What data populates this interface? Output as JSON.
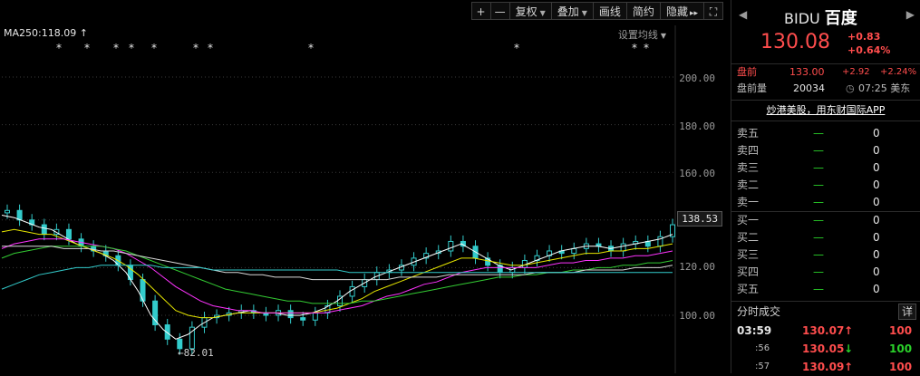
{
  "toolbar": {
    "zoom_in": "+",
    "zoom_out": "—",
    "adjust": "复权",
    "overlay": "叠加",
    "draw": "画线",
    "simple": "简约",
    "hide": "隐藏",
    "more": "▸▸",
    "expand": "⛶"
  },
  "chart": {
    "ma_label": "MA250:118.09",
    "ma_settings": "设置均线",
    "y_ticks": [
      "200.00",
      "180.00",
      "160.00",
      "140.00",
      "120.00",
      "100.00"
    ],
    "last_price_tag": "138.53",
    "low_label": "82.01",
    "star_glyph": "*"
  },
  "chart_data": {
    "type": "line",
    "ylim": [
      80,
      210
    ],
    "series": [
      {
        "values": [
          142,
          141,
          139,
          137,
          136,
          133,
          130,
          128,
          126,
          123,
          118,
          110,
          100,
          94,
          90,
          92,
          96,
          99,
          100,
          101,
          102,
          101,
          101,
          100,
          100,
          101,
          103,
          106,
          110,
          113,
          116,
          118,
          120,
          122,
          124,
          126,
          128,
          130,
          127,
          124,
          121,
          119,
          121,
          123,
          125,
          127,
          128,
          129,
          129,
          128,
          129,
          130,
          131,
          132,
          134
        ]
      },
      {
        "values": [
          135,
          136,
          135,
          134,
          134,
          132,
          130,
          128,
          126,
          124,
          121,
          117,
          112,
          107,
          102,
          100,
          99,
          99,
          100,
          101,
          101,
          101,
          101,
          101,
          101,
          101,
          102,
          103,
          105,
          107,
          110,
          112,
          114,
          116,
          118,
          120,
          122,
          124,
          124,
          123,
          122,
          121,
          121,
          122,
          123,
          124,
          125,
          126,
          126,
          127,
          127,
          128,
          128,
          129,
          130
        ]
      },
      {
        "values": [
          128,
          130,
          131,
          132,
          132,
          132,
          131,
          130,
          129,
          128,
          126,
          123,
          120,
          116,
          112,
          109,
          106,
          104,
          103,
          102,
          102,
          101,
          101,
          101,
          101,
          101,
          101,
          102,
          103,
          104,
          106,
          108,
          109,
          111,
          113,
          114,
          116,
          118,
          119,
          120,
          120,
          120,
          120,
          120,
          121,
          122,
          122,
          123,
          123,
          124,
          124,
          125,
          125,
          126,
          127
        ]
      },
      {
        "values": [
          124,
          126,
          127,
          128,
          129,
          129,
          129,
          129,
          129,
          128,
          127,
          125,
          123,
          121,
          119,
          117,
          115,
          113,
          111,
          110,
          109,
          108,
          107,
          106,
          106,
          105,
          105,
          105,
          105,
          106,
          106,
          107,
          108,
          109,
          110,
          111,
          112,
          113,
          114,
          115,
          116,
          116,
          117,
          117,
          118,
          118,
          119,
          119,
          120,
          120,
          121,
          121,
          122,
          122,
          123
        ]
      },
      {
        "values": [
          129,
          129,
          129,
          129,
          129,
          128,
          128,
          128,
          127,
          127,
          126,
          125,
          124,
          123,
          122,
          121,
          120,
          119,
          118,
          118,
          117,
          117,
          116,
          116,
          116,
          115,
          115,
          115,
          115,
          115,
          115,
          115,
          116,
          116,
          116,
          116,
          117,
          117,
          117,
          117,
          117,
          117,
          117,
          118,
          118,
          118,
          118,
          119,
          119,
          119,
          119,
          120,
          120,
          120,
          121
        ]
      },
      {
        "values": [
          111,
          113,
          115,
          117,
          118,
          119,
          120,
          120,
          121,
          121,
          121,
          121,
          121,
          120,
          120,
          120,
          120,
          119,
          119,
          119,
          119,
          119,
          119,
          119,
          119,
          119,
          119,
          119,
          118,
          118,
          118,
          118,
          118,
          118,
          118,
          118,
          118,
          118,
          118,
          118,
          118,
          118,
          118,
          118,
          118,
          118,
          118,
          118,
          118,
          118,
          118,
          118,
          118,
          118,
          118
        ]
      }
    ],
    "candles_close": [
      144,
      140,
      138,
      134,
      136,
      132,
      129,
      127,
      125,
      121,
      115,
      106,
      96,
      90,
      86,
      95,
      99,
      100,
      101,
      102,
      101,
      100,
      102,
      99,
      98,
      101,
      104,
      108,
      112,
      115,
      118,
      119,
      121,
      124,
      126,
      127,
      131,
      129,
      124,
      121,
      118,
      120,
      123,
      125,
      127,
      126,
      128,
      130,
      129,
      127,
      130,
      131,
      129,
      133,
      138
    ]
  },
  "quote": {
    "symbol": "BIDU",
    "name": "百度",
    "price": "130.08",
    "change": "+0.83",
    "change_pct": "+0.64%",
    "pre_label": "盘前",
    "pre_price": "133.00",
    "pre_change": "+2.92",
    "pre_change_pct": "+2.24%",
    "pre_vol_label": "盘前量",
    "pre_vol": "20034",
    "time": "07:25 美东",
    "promo": "炒港美股，用东财国际APP"
  },
  "order_book": {
    "asks": [
      {
        "label": "卖五",
        "price": "—",
        "vol": "0"
      },
      {
        "label": "卖四",
        "price": "—",
        "vol": "0"
      },
      {
        "label": "卖三",
        "price": "—",
        "vol": "0"
      },
      {
        "label": "卖二",
        "price": "—",
        "vol": "0"
      },
      {
        "label": "卖一",
        "price": "—",
        "vol": "0"
      }
    ],
    "bids": [
      {
        "label": "买一",
        "price": "—",
        "vol": "0"
      },
      {
        "label": "买二",
        "price": "—",
        "vol": "0"
      },
      {
        "label": "买三",
        "price": "—",
        "vol": "0"
      },
      {
        "label": "买四",
        "price": "—",
        "vol": "0"
      },
      {
        "label": "买五",
        "price": "—",
        "vol": "0"
      }
    ]
  },
  "trades": {
    "title": "分时成交",
    "detail": "详",
    "rows": [
      {
        "time": "03:59",
        "price": "130.07",
        "dir": "↑",
        "vol": "100"
      },
      {
        "time": ":56",
        "price": "130.05",
        "dir": "↓",
        "vol": "100"
      },
      {
        "time": ":57",
        "price": "130.09",
        "dir": "↑",
        "vol": "100"
      }
    ]
  },
  "colors": {
    "up": "#ff4d4d",
    "down": "#2ad12a",
    "ma_colors": [
      "#ffffff",
      "#e6e600",
      "#ff33ff",
      "#33cc33",
      "#d8d8d8",
      "#33cccc"
    ]
  }
}
